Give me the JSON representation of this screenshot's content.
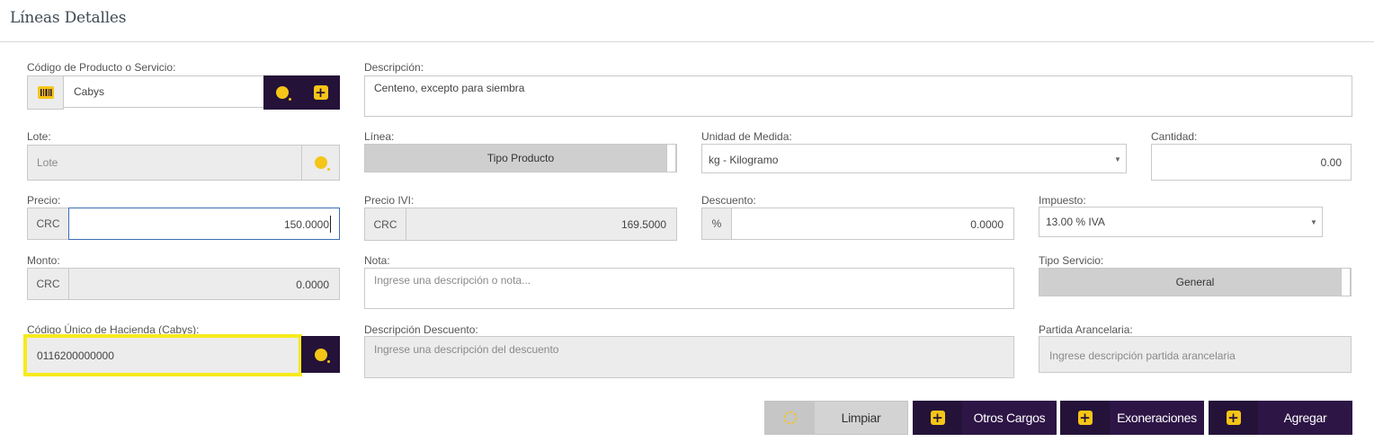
{
  "page": {
    "title": "Líneas Detalles"
  },
  "producto": {
    "label": "Código de Producto o Servicio:",
    "value": "Cabys",
    "barcode_icon": "barcode-icon",
    "search_icon": "search-icon",
    "add_icon": "plus-icon"
  },
  "descripcion": {
    "label": "Descripción:",
    "value": "Centeno, excepto para siembra"
  },
  "lote": {
    "label": "Lote:",
    "placeholder": "Lote"
  },
  "linea": {
    "label": "Línea:",
    "toggle_text": "Tipo Producto"
  },
  "unidad": {
    "label": "Unidad de Medida:",
    "selected": "kg - Kilogramo"
  },
  "cantidad": {
    "label": "Cantidad:",
    "value": "0.00"
  },
  "precio": {
    "label": "Precio:",
    "currency": "CRC",
    "value": "150.0000"
  },
  "precio_ivi": {
    "label": "Precio IVI:",
    "currency": "CRC",
    "value": "169.5000"
  },
  "descuento": {
    "label": "Descuento:",
    "symbol": "%",
    "value": "0.0000"
  },
  "impuesto": {
    "label": "Impuesto:",
    "selected": "13.00 % IVA"
  },
  "monto": {
    "label": "Monto:",
    "currency": "CRC",
    "value": "0.0000"
  },
  "nota": {
    "label": "Nota:",
    "placeholder": "Ingrese una descripción o nota..."
  },
  "tipo_servicio": {
    "label": "Tipo Servicio:",
    "toggle_text": "General"
  },
  "cabys": {
    "label": "Código Único de Hacienda (Cabys):",
    "value": "0116200000000"
  },
  "desc_descuento": {
    "label": "Descripción Descuento:",
    "placeholder": "Ingrese una descripción del descuento"
  },
  "partida": {
    "label": "Partida Arancelaria:",
    "placeholder": "Ingrese descripción partida arancelaria"
  },
  "buttons": {
    "limpiar": "Limpiar",
    "otros_cargos": "Otros Cargos",
    "exoneraciones": "Exoneraciones",
    "agregar": "Agregar"
  },
  "colors": {
    "dark": "#241238",
    "accent": "#f5c518",
    "highlight": "#f7ea1c"
  }
}
